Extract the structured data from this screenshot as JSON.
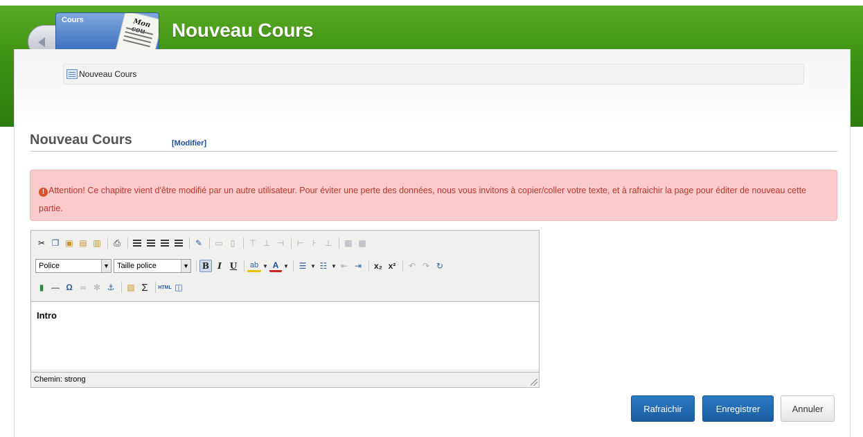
{
  "header": {
    "title": "Nouveau Cours",
    "icon_label": "Cours",
    "icon_paper_text": "Mon cou"
  },
  "breadcrumb": {
    "label": "Nouveau Cours"
  },
  "section": {
    "title": "Nouveau Cours",
    "modify_link": "[Modifier]"
  },
  "alert": {
    "text": "Attention! Ce chapitre vient d'être modifié par un autre utilisateur. Pour éviter une perte des données, nous vous invitons à copier/coller votre texte, et à rafraichir la page pour éditer de nouveau cette partie."
  },
  "editor": {
    "font_select": "Police",
    "size_select": "Taille police",
    "content": "Intro",
    "status_path": "Chemin: strong"
  },
  "actions": {
    "refresh": "Rafraichir",
    "save": "Enregistrer",
    "cancel": "Annuler"
  },
  "colors": {
    "header_green": "#3f9216",
    "primary_blue": "#1f67ad",
    "alert_bg": "#fbcaca",
    "alert_text": "#b8372f"
  }
}
